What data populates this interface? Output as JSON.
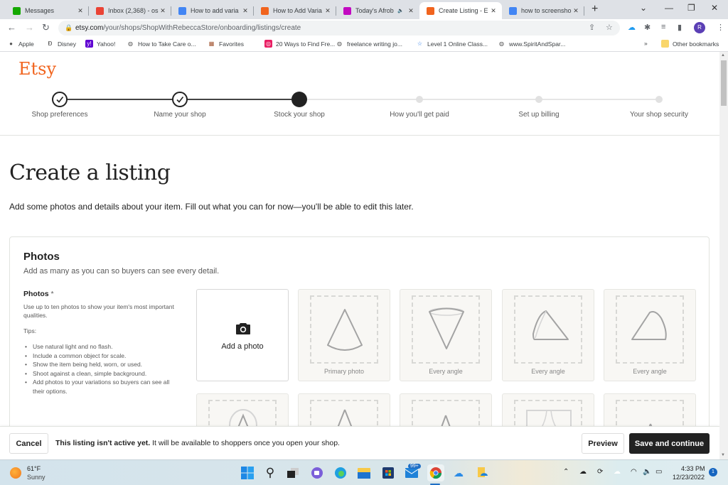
{
  "browser": {
    "tabs": [
      {
        "title": "Messages",
        "favicon": "upwork-icon",
        "color": "#14a800",
        "active": false
      },
      {
        "title": "Inbox (2,368) - os",
        "favicon": "gmail-icon",
        "color": "#ea4335",
        "active": false
      },
      {
        "title": "How to add varia",
        "favicon": "google-docs-icon",
        "color": "#4285f4",
        "active": false
      },
      {
        "title": "How to Add Varia",
        "favicon": "etsy-icon",
        "color": "#f1641e",
        "active": false
      },
      {
        "title": "Today's Afrob",
        "favicon": "picsart-icon",
        "color": "#c209c1",
        "active": false,
        "audio": true
      },
      {
        "title": "Create Listing - E",
        "favicon": "etsy-icon",
        "color": "#f1641e",
        "active": true
      },
      {
        "title": "how to screensho",
        "favicon": "google-icon",
        "color": "#4285f4",
        "active": false
      }
    ],
    "url_host": "etsy.com",
    "url_path": "/your/shops/ShopWithRebeccaStore/onboarding/listings/create",
    "profile_initial": "R",
    "bookmarks": [
      {
        "label": "Apple",
        "icon": "apple-icon"
      },
      {
        "label": "Disney",
        "icon": "disney-icon"
      },
      {
        "label": "Yahoo!",
        "icon": "yahoo-icon"
      },
      {
        "label": "How to Take Care o...",
        "icon": "globe-icon"
      },
      {
        "label": "Favorites",
        "icon": "favorites-icon"
      },
      {
        "label": "20 Ways to Find Fre...",
        "icon": "site-icon"
      },
      {
        "label": "freelance writing jo...",
        "icon": "globe-icon"
      },
      {
        "label": "Level 1 Online Class...",
        "icon": "star-icon"
      },
      {
        "label": "www.SpiritAndSpar...",
        "icon": "globe-icon"
      }
    ],
    "other_bookmarks": "Other bookmarks",
    "overflow": "»"
  },
  "etsy": {
    "logo": "Etsy",
    "brand_color": "#f1641e",
    "steps": [
      {
        "label": "Shop preferences",
        "state": "done"
      },
      {
        "label": "Name your shop",
        "state": "done"
      },
      {
        "label": "Stock your shop",
        "state": "current"
      },
      {
        "label": "How you'll get paid",
        "state": "future"
      },
      {
        "label": "Set up billing",
        "state": "future"
      },
      {
        "label": "Your shop security",
        "state": "future"
      }
    ],
    "title": "Create a listing",
    "subtitle": "Add some photos and details about your item. Fill out what you can for now—you'll be able to edit this later.",
    "photos": {
      "heading": "Photos",
      "subheading": "Add as many as you can so buyers can see every detail.",
      "field_label": "Photos",
      "required_mark": "*",
      "description": "Use up to ten photos to show your item's most important qualities.",
      "tips_label": "Tips:",
      "tips": [
        "Use natural light and no flash.",
        "Include a common object for scale.",
        "Show the item being held, worn, or used.",
        "Shoot against a clean, simple background.",
        "Add photos to your variations so buyers can see all their options."
      ],
      "add_photo_label": "Add a photo",
      "slots_row1": [
        "Primary photo",
        "Every angle",
        "Every angle",
        "Every angle"
      ]
    },
    "bottom_bar": {
      "cancel": "Cancel",
      "notice_bold": "This listing isn't active yet.",
      "notice_rest": " It will be available to shoppers once you open your shop.",
      "preview": "Preview",
      "save": "Save and continue"
    }
  },
  "taskbar": {
    "weather_temp": "61°F",
    "weather_cond": "Sunny",
    "mail_badge": "99+",
    "time": "4:33 PM",
    "date": "12/23/2022",
    "notifications": "1"
  }
}
